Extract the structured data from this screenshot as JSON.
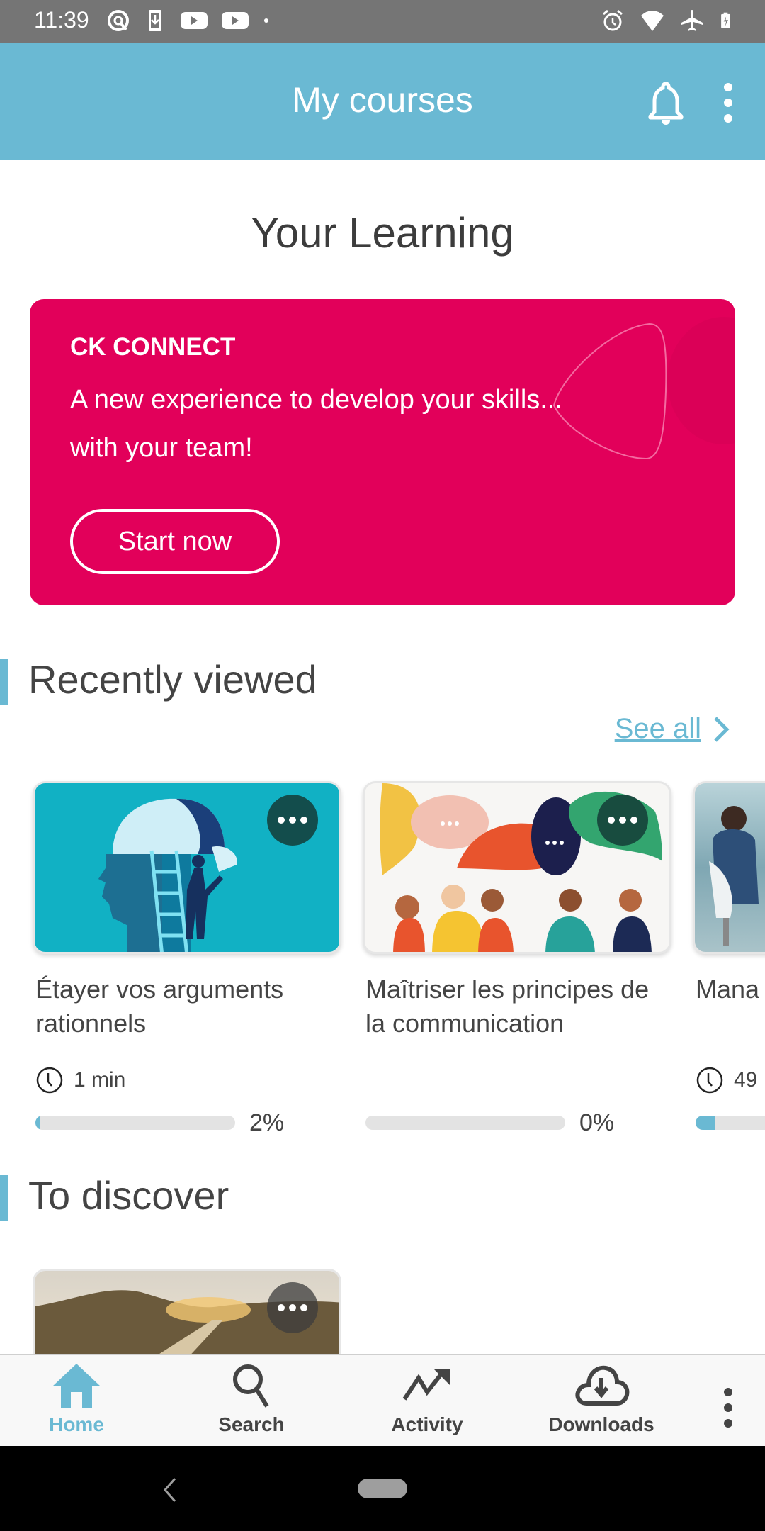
{
  "status_bar": {
    "time": "11:39",
    "left_icons": [
      "vpn-key-icon",
      "download-notification-icon",
      "youtube-icon",
      "youtube-icon",
      "dot-icon"
    ],
    "right_icons": [
      "alarm-icon",
      "wifi-icon",
      "airplane-mode-icon",
      "battery-charging-icon"
    ]
  },
  "app_bar": {
    "title": "My courses",
    "actions": [
      "bell-icon",
      "more-vert-icon"
    ]
  },
  "page": {
    "heading": "Your Learning"
  },
  "promo": {
    "kicker": "CK CONNECT",
    "text": "A new experience to develop your skills... with your team!",
    "button_label": "Start now",
    "color": "#e2005a"
  },
  "recently_viewed": {
    "title": "Recently viewed",
    "see_all_label": "See all",
    "courses": [
      {
        "title": "Étayer vos arguments rationnels",
        "duration": "1 min",
        "progress": 2,
        "progress_label": "2%",
        "thumbnail": "brain-ladder-illustration"
      },
      {
        "title": "Maîtriser les principes de la communication",
        "duration": "",
        "progress": 0,
        "progress_label": "0%",
        "thumbnail": "people-speech-bubbles-illustration"
      },
      {
        "title": "Mana d'emp",
        "duration": "49",
        "progress": 10,
        "progress_label": "",
        "thumbnail": "office-meeting-photo"
      }
    ]
  },
  "to_discover": {
    "title": "To discover",
    "courses": [
      {
        "thumbnail": "dunes-boardwalk-photo"
      }
    ]
  },
  "bottom_nav": {
    "items": [
      {
        "label": "Home",
        "icon": "home-icon",
        "active": true
      },
      {
        "label": "Search",
        "icon": "search-icon",
        "active": false
      },
      {
        "label": "Activity",
        "icon": "trending-up-icon",
        "active": false
      },
      {
        "label": "Downloads",
        "icon": "cloud-download-icon",
        "active": false
      }
    ],
    "more_icon": "more-vert-icon"
  },
  "colors": {
    "accent": "#6ab9d3",
    "promo": "#e2005a",
    "text": "#444444"
  }
}
